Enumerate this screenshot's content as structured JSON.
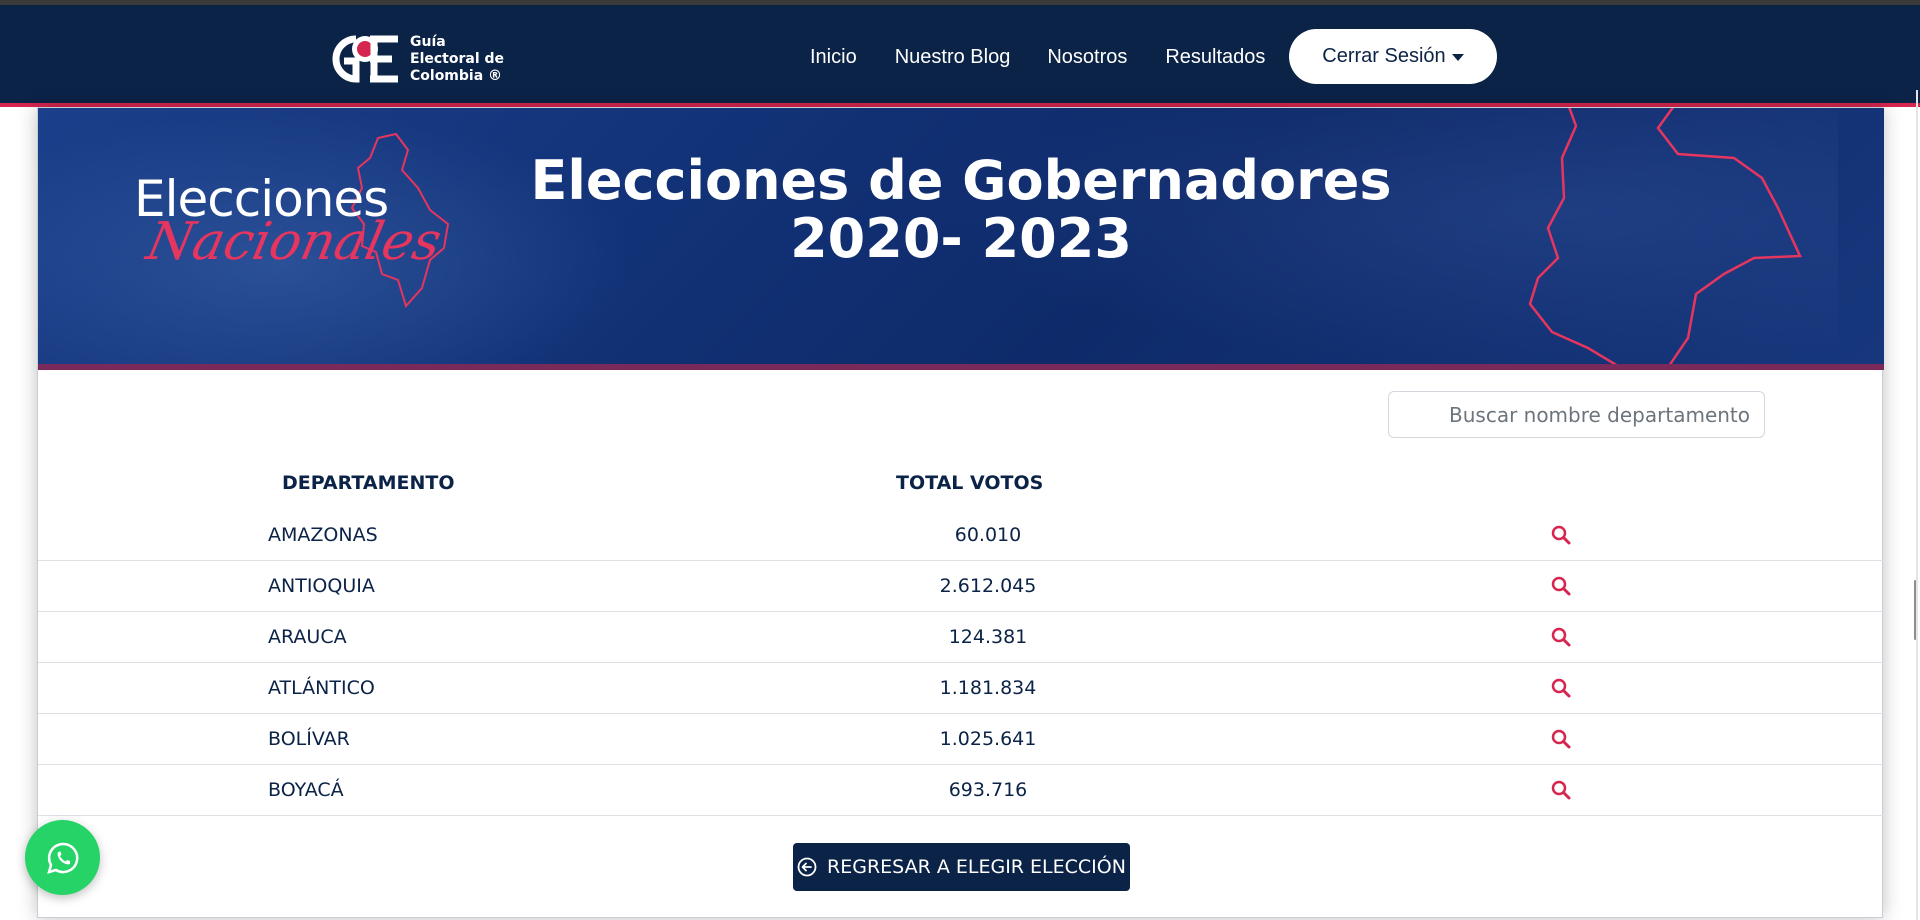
{
  "nav": {
    "logo_line1": "Guía",
    "logo_line2": "Electoral de",
    "logo_line3": "Colombia ®",
    "links": [
      "Inicio",
      "Nuestro Blog",
      "Nosotros",
      "Resultados"
    ],
    "logout_label": "Cerrar Sesión"
  },
  "banner": {
    "left_word1": "Elecciones",
    "left_word2": "Nacionales",
    "title_line1": "Elecciones de Gobernadores",
    "title_line2": "2020- 2023"
  },
  "search": {
    "placeholder": "Buscar nombre departamento"
  },
  "table": {
    "headers": {
      "departamento": "DEPARTAMENTO",
      "total": "TOTAL VOTOS"
    },
    "rows": [
      {
        "departamento": "AMAZONAS",
        "total": "60.010"
      },
      {
        "departamento": "ANTIOQUIA",
        "total": "2.612.045"
      },
      {
        "departamento": "ARAUCA",
        "total": "124.381"
      },
      {
        "departamento": "ATLÁNTICO",
        "total": "1.181.834"
      },
      {
        "departamento": "BOLÍVAR",
        "total": "1.025.641"
      },
      {
        "departamento": "BOYACÁ",
        "total": "693.716"
      }
    ]
  },
  "back_button": "REGRESAR A ELEGIR ELECCIÓN",
  "colors": {
    "navy": "#0b2347",
    "accent": "#d6264f",
    "whatsapp": "#25d366"
  },
  "icons": [
    "search-icon",
    "back-arrow-icon",
    "whatsapp-icon",
    "caret-down-icon"
  ]
}
